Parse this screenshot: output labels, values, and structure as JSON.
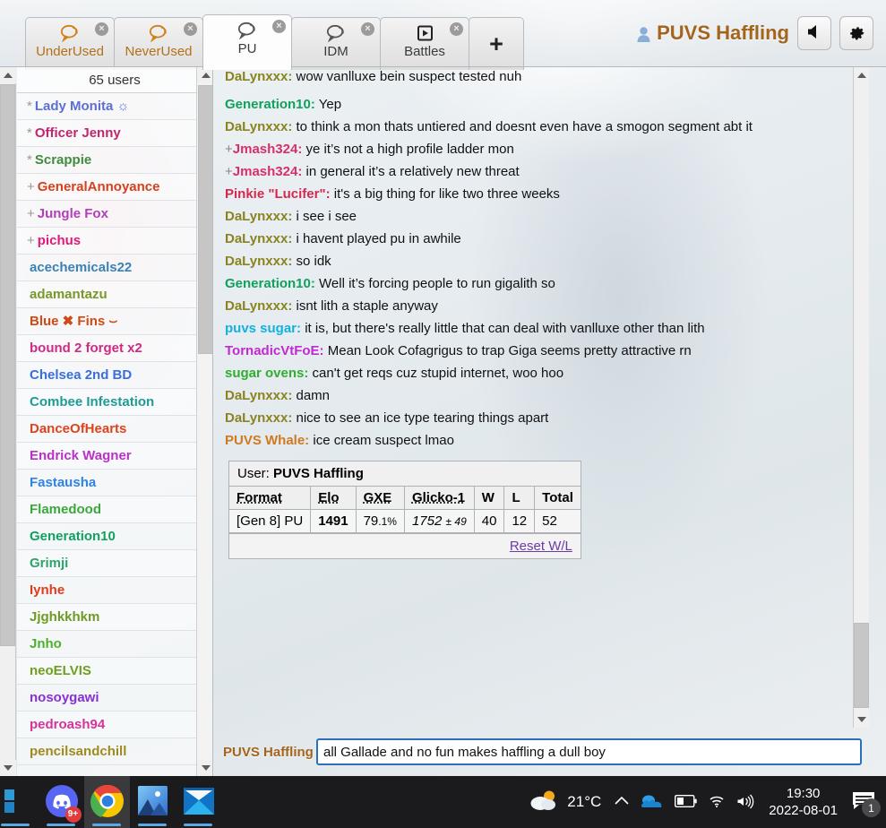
{
  "tabs": [
    {
      "label": "UnderUsed",
      "icon": "chat-icon",
      "unread": true,
      "active": false,
      "closable": true
    },
    {
      "label": "NeverUsed",
      "icon": "chat-icon",
      "unread": true,
      "active": false,
      "closable": true
    },
    {
      "label": "PU",
      "icon": "chat-icon",
      "unread": false,
      "active": true,
      "closable": true
    },
    {
      "label": "IDM",
      "icon": "chat-icon",
      "unread": false,
      "active": false,
      "closable": true
    },
    {
      "label": "Battles",
      "icon": "battle-icon",
      "unread": false,
      "active": false,
      "closable": true
    }
  ],
  "new_tab_label": "+",
  "close_glyph": "×",
  "header": {
    "username": "PUVS Haffling",
    "avatar_icon": "user-avatar-icon",
    "volume_icon": "volume-icon",
    "settings_icon": "gear-icon"
  },
  "userlist": {
    "header": "65 users",
    "users": [
      {
        "rank": "*",
        "name": "Lady Monita ☼",
        "color": "#5b6fd6"
      },
      {
        "rank": "*",
        "name": "Officer Jenny",
        "color": "#c0266e"
      },
      {
        "rank": "*",
        "name": "Scrappie",
        "color": "#3f8c3f"
      },
      {
        "rank": "+",
        "name": "GeneralAnnoyance",
        "color": "#d6401e"
      },
      {
        "rank": "+",
        "name": "Jungle Fox",
        "color": "#b13fba"
      },
      {
        "rank": "+",
        "name": "pichus",
        "color": "#e0197a"
      },
      {
        "rank": "",
        "name": "acechemicals22",
        "color": "#3a82b4"
      },
      {
        "rank": "",
        "name": "adamantazu",
        "color": "#79982a"
      },
      {
        "rank": "",
        "name": "Blue ✖ Fins ⌣",
        "color": "#cf4a14"
      },
      {
        "rank": "",
        "name": "bound 2 forget x2",
        "color": "#cf2a86"
      },
      {
        "rank": "",
        "name": "Chelsea 2nd BD",
        "color": "#3a6ee0"
      },
      {
        "rank": "",
        "name": "Combee Infestation",
        "color": "#1f9b96"
      },
      {
        "rank": "",
        "name": "DanceOfHearts",
        "color": "#e0421c"
      },
      {
        "rank": "",
        "name": "Endrick Wagner",
        "color": "#bb30c6"
      },
      {
        "rank": "",
        "name": "Fastausha",
        "color": "#2f82e8"
      },
      {
        "rank": "",
        "name": "Flamedood",
        "color": "#3aa83a"
      },
      {
        "rank": "",
        "name": "Generation10",
        "color": "#12a05e"
      },
      {
        "rank": "",
        "name": "Grimji",
        "color": "#2da46b"
      },
      {
        "rank": "",
        "name": "Iynhe",
        "color": "#e33a1c"
      },
      {
        "rank": "",
        "name": "Jjghkkhkm",
        "color": "#6f9a23"
      },
      {
        "rank": "",
        "name": "Jnho",
        "color": "#4eb02a"
      },
      {
        "rank": "",
        "name": "neoELVIS",
        "color": "#6f9f1f"
      },
      {
        "rank": "",
        "name": "nosoygawi",
        "color": "#8a2fd6"
      },
      {
        "rank": "",
        "name": "pedroash94",
        "color": "#d6329a"
      },
      {
        "rank": "",
        "name": "pencilsandchill",
        "color": "#a08a20"
      }
    ]
  },
  "chat": {
    "messages": [
      {
        "rank": "",
        "who": "DaLynxxx",
        "color": "#8a8420",
        "body": "wow vanlluxe bein suspect tested nuh",
        "cut": true
      },
      {
        "rank": "",
        "who": "Generation10",
        "color": "#12a05e",
        "body": "Yep"
      },
      {
        "rank": "",
        "who": "DaLynxxx",
        "color": "#8a8420",
        "body": "to think a mon thats untiered and doesnt even have a smogon segment abt it"
      },
      {
        "rank": "+",
        "who": "Jmash324",
        "color": "#d6306a",
        "body": "ye it’s not a high profile ladder mon"
      },
      {
        "rank": "+",
        "who": "Jmash324",
        "color": "#d6306a",
        "body": "in general it’s a relatively new threat"
      },
      {
        "rank": "",
        "who": "Pinkie \"Lucifer\"",
        "color": "#d6284e",
        "body": "it's a big thing for like two three weeks"
      },
      {
        "rank": "",
        "who": "DaLynxxx",
        "color": "#8a8420",
        "body": "i see i see"
      },
      {
        "rank": "",
        "who": "DaLynxxx",
        "color": "#8a8420",
        "body": "i havent played pu in awhile"
      },
      {
        "rank": "",
        "who": "DaLynxxx",
        "color": "#8a8420",
        "body": "so idk"
      },
      {
        "rank": "",
        "who": "Generation10",
        "color": "#12a05e",
        "body": "Well it’s forcing people to run gigalith so"
      },
      {
        "rank": "",
        "who": "DaLynxxx",
        "color": "#8a8420",
        "body": "isnt lith a staple anyway"
      },
      {
        "rank": "",
        "who": "puvs sugar",
        "color": "#11b2e0",
        "body": "it is, but there's really little that can deal with vanlluxe other than lith"
      },
      {
        "rank": "",
        "who": "TornadicVtFoE",
        "color": "#c02ad0",
        "body": "Mean Look Cofagrigus to trap Giga seems pretty attractive rn"
      },
      {
        "rank": "",
        "who": "sugar ovens",
        "color": "#2fae2f",
        "body": "can't get reqs cuz stupid internet, woo hoo"
      },
      {
        "rank": "",
        "who": "DaLynxxx",
        "color": "#8a8420",
        "body": "damn"
      },
      {
        "rank": "",
        "who": "DaLynxxx",
        "color": "#8a8420",
        "body": "nice to see an ice type tearing things apart"
      },
      {
        "rank": "",
        "who": "PUVS Whale",
        "color": "#cf7a1e",
        "body": "ice cream suspect lmao"
      }
    ],
    "ratings": {
      "user_label": "User:",
      "user_name": "PUVS Haffling",
      "columns": [
        "Format",
        "Elo",
        "GXE",
        "Glicko-1",
        "W",
        "L",
        "Total"
      ],
      "rows": [
        {
          "format": "[Gen 8] PU",
          "elo": "1491",
          "gxe_int": "79",
          "gxe_dec": ".1%",
          "glicko": "1752",
          "glicko_pm": "± 49",
          "w": "40",
          "l": "12",
          "total": "52"
        }
      ],
      "reset_label": "Reset W/L"
    },
    "input": {
      "username": "PUVS Haffling",
      "value": "all Gallade and no fun makes haffling a dull boy",
      "placeholder": ""
    }
  },
  "taskbar": {
    "apps": [
      {
        "name": "store-icon",
        "active": false,
        "running": true,
        "badge": ""
      },
      {
        "name": "discord-icon",
        "active": false,
        "running": true,
        "badge": "9+"
      },
      {
        "name": "chrome-icon",
        "active": true,
        "running": true,
        "badge": ""
      },
      {
        "name": "photos-icon",
        "active": false,
        "running": true,
        "badge": ""
      },
      {
        "name": "mail-icon",
        "active": false,
        "running": true,
        "badge": ""
      }
    ],
    "weather": {
      "temp": "21°C",
      "icon": "partly-cloudy-icon"
    },
    "tray": [
      "chevron-up-icon",
      "onedrive-icon",
      "battery-icon",
      "wifi-icon",
      "volume-icon"
    ],
    "clock": {
      "time": "19:30",
      "date": "2022-08-01"
    },
    "notifications": {
      "count": "1",
      "icon": "notification-icon"
    }
  }
}
